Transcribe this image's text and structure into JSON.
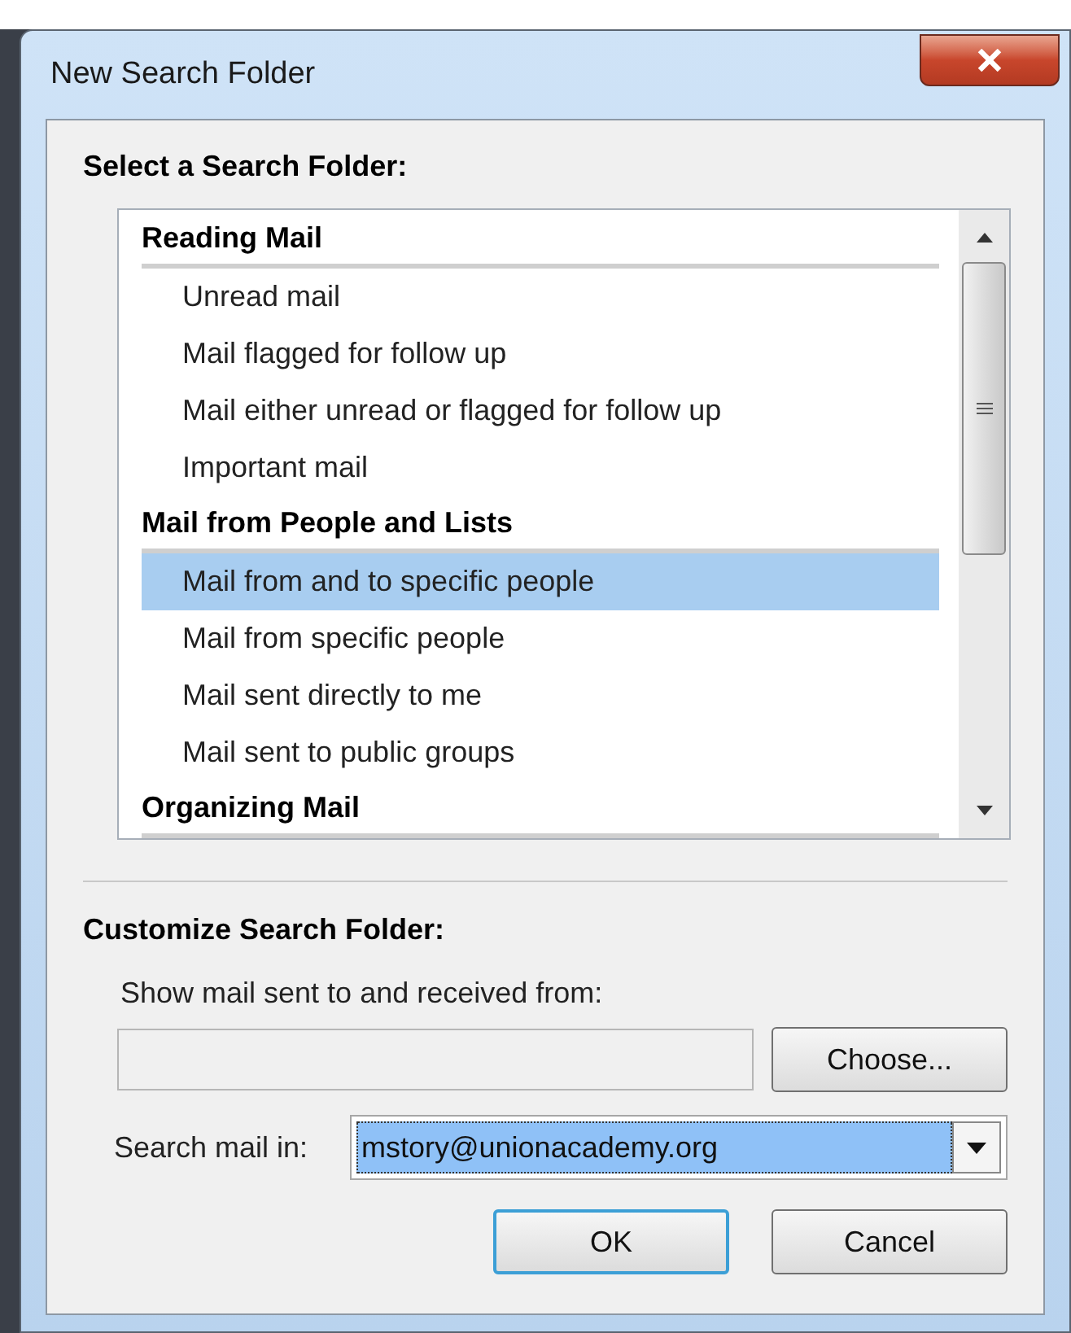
{
  "window": {
    "title": "New Search Folder"
  },
  "select_section": {
    "heading": "Select a Search Folder:"
  },
  "folder_list": [
    {
      "kind": "group",
      "label": "Reading Mail"
    },
    {
      "kind": "item",
      "label": "Unread mail",
      "selected": false
    },
    {
      "kind": "item",
      "label": "Mail flagged for follow up",
      "selected": false
    },
    {
      "kind": "item",
      "label": "Mail either unread or flagged for follow up",
      "selected": false
    },
    {
      "kind": "item",
      "label": "Important mail",
      "selected": false
    },
    {
      "kind": "group",
      "label": "Mail from People and Lists"
    },
    {
      "kind": "item",
      "label": "Mail from and to specific people",
      "selected": true
    },
    {
      "kind": "item",
      "label": "Mail from specific people",
      "selected": false
    },
    {
      "kind": "item",
      "label": "Mail sent directly to me",
      "selected": false
    },
    {
      "kind": "item",
      "label": "Mail sent to public groups",
      "selected": false
    },
    {
      "kind": "group",
      "label": "Organizing Mail"
    }
  ],
  "customize_section": {
    "heading": "Customize Search Folder:",
    "people_label": "Show mail sent to and received from:",
    "choose_button": "Choose...",
    "search_in_label": "Search mail in:",
    "search_in_value": "mstory@unionacademy.org"
  },
  "buttons": [
    {
      "label": "OK",
      "default": true
    },
    {
      "label": "Cancel",
      "default": false
    }
  ]
}
